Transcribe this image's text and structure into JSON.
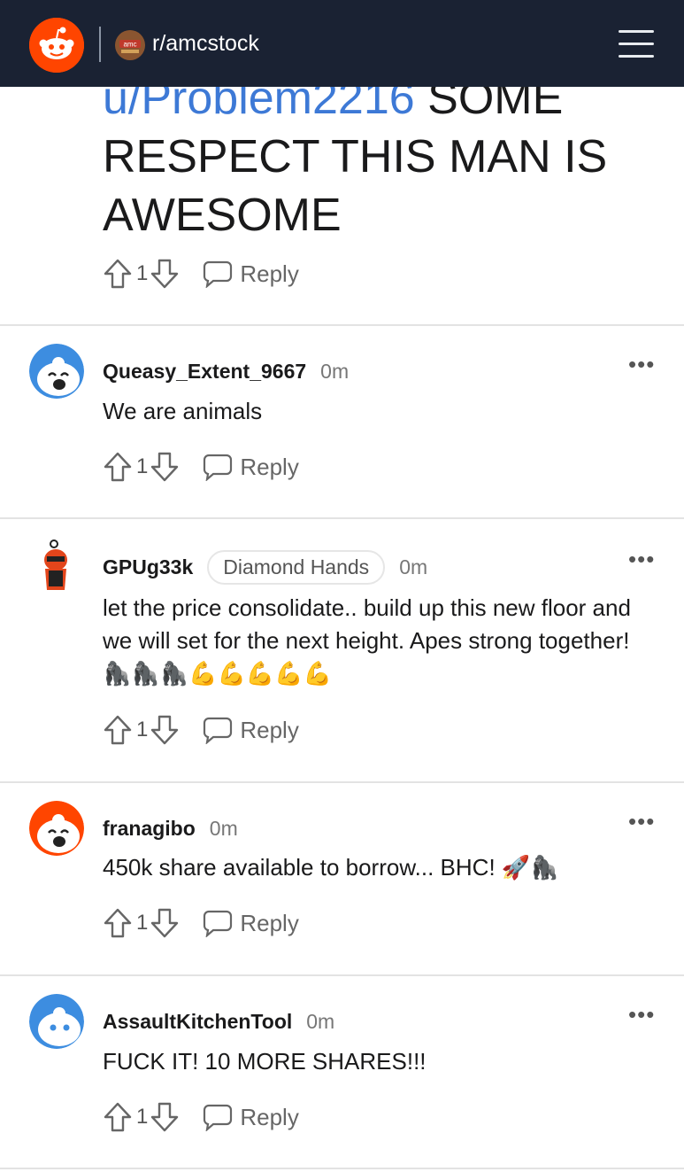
{
  "header": {
    "subreddit": "r/amcstock",
    "subreddit_icon_text": "amc"
  },
  "post": {
    "link_text": "u/Problem2216",
    "text": " SOME RESPECT THIS MAN IS AWESOME",
    "score": "1",
    "reply_label": "Reply"
  },
  "comments": [
    {
      "username": "Queasy_Extent_9667",
      "age": "0m",
      "flair": "",
      "text": "We are animals",
      "score": "1",
      "reply_label": "Reply"
    },
    {
      "username": "GPUg33k",
      "age": "0m",
      "flair": "Diamond Hands",
      "text": "let the price consolidate.. build up this new floor and we will set for the next height. Apes strong together! 🦍🦍🦍💪💪💪💪💪",
      "score": "1",
      "reply_label": "Reply"
    },
    {
      "username": "franagibo",
      "age": "0m",
      "flair": "",
      "text": "450k share available to borrow... BHC! 🚀🦍",
      "score": "1",
      "reply_label": "Reply"
    },
    {
      "username": "AssaultKitchenTool",
      "age": "0m",
      "flair": "",
      "text": "FUCK IT! 10 MORE SHARES!!!",
      "score": "1",
      "reply_label": "Reply"
    }
  ],
  "icons": {
    "logo": "reddit-logo",
    "menu": "hamburger-menu-icon",
    "upvote": "arrow-up-icon",
    "downvote": "arrow-down-icon",
    "reply": "speech-bubble-icon",
    "more": "more-options-icon"
  },
  "colors": {
    "header_bg": "#1a2233",
    "reddit_orange": "#ff4500",
    "link_blue": "#3d79d6"
  }
}
